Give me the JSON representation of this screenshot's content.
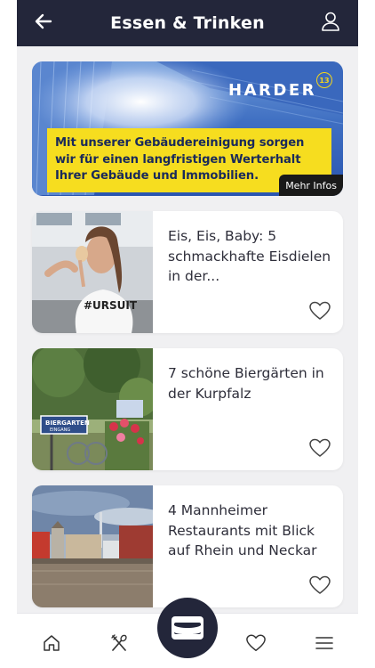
{
  "header": {
    "title": "Essen & Trinken",
    "back_icon": "arrow-left-icon",
    "profile_icon": "user-icon"
  },
  "ad": {
    "brand": "HARDER",
    "brand_badge": "13",
    "lines": [
      "Mit unserer Gebäudereinigung sorgen",
      "wir für einen langfristigen Werterhalt",
      "Ihrer Gebäude und Immobilien."
    ],
    "more_label": "Mehr Infos",
    "colors": {
      "promo_bg": "#f6dd1f",
      "promo_text": "#1a2a5a"
    }
  },
  "articles": [
    {
      "title": "Eis, Eis, Baby: 5 schmackhafte Eisdielen in der..."
    },
    {
      "title": "7 schöne Biergärten in der Kurpfalz",
      "sign_text": [
        "BIERGARTEN",
        "EINGANG"
      ]
    },
    {
      "title": "4 Mannheimer Restaurants mit Blick auf Rhein und Neckar"
    }
  ],
  "tabbar": {
    "items": [
      "home-icon",
      "cutlery-icon",
      "wallet-icon",
      "heart-icon",
      "menu-icon"
    ]
  },
  "colors": {
    "header_bg": "#23263a",
    "page_bg": "#f0f0f2",
    "card_bg": "#ffffff",
    "text": "#2e2e3a"
  }
}
